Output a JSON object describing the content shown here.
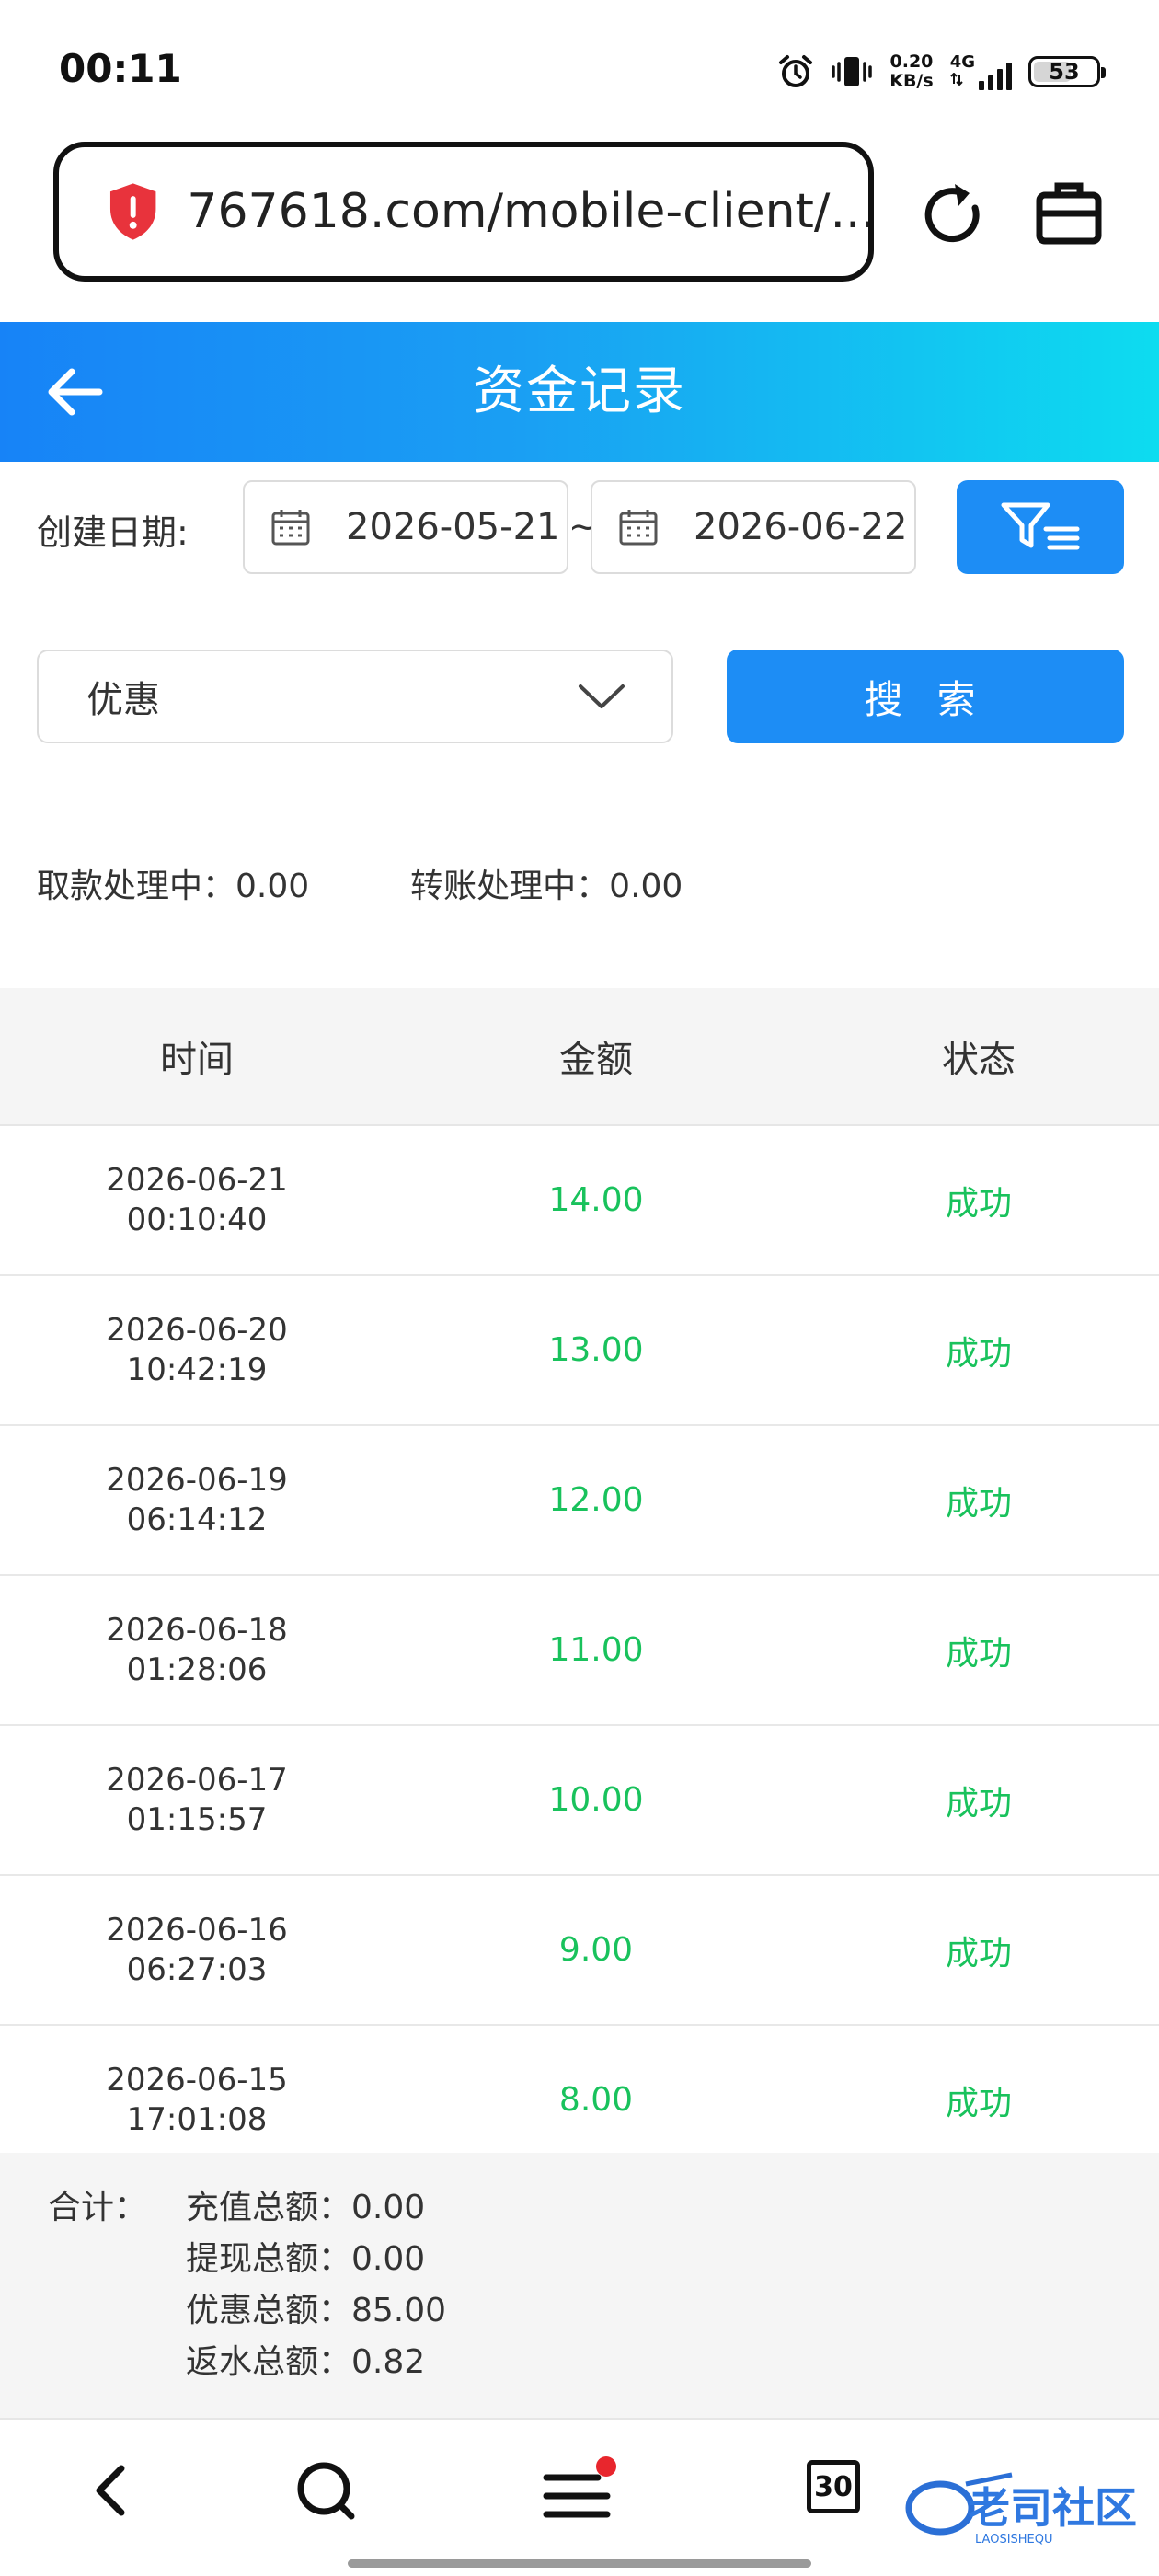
{
  "status_bar": {
    "time": "00:11",
    "net_speed_value": "0.20",
    "net_speed_unit": "KB/s",
    "network_type": "4G",
    "battery": "53"
  },
  "browser": {
    "url": "767618.com/mobile-client/..."
  },
  "header": {
    "title": "资金记录"
  },
  "filters": {
    "date_label": "创建日期:",
    "start_date": "2026-05-21",
    "separator": "~",
    "end_date": "2026-06-22",
    "type_selected": "优惠",
    "search_label": "搜 索"
  },
  "pending": {
    "withdraw": "取款处理中：0.00",
    "transfer": "转账处理中：0.00"
  },
  "table": {
    "headers": [
      "时间",
      "金额",
      "状态"
    ],
    "rows": [
      {
        "date": "2026-06-21",
        "time": "00:10:40",
        "amount": "14.00",
        "status": "成功"
      },
      {
        "date": "2026-06-20",
        "time": "10:42:19",
        "amount": "13.00",
        "status": "成功"
      },
      {
        "date": "2026-06-19",
        "time": "06:14:12",
        "amount": "12.00",
        "status": "成功"
      },
      {
        "date": "2026-06-18",
        "time": "01:28:06",
        "amount": "11.00",
        "status": "成功"
      },
      {
        "date": "2026-06-17",
        "time": "01:15:57",
        "amount": "10.00",
        "status": "成功"
      },
      {
        "date": "2026-06-16",
        "time": "06:27:03",
        "amount": "9.00",
        "status": "成功"
      },
      {
        "date": "2026-06-15",
        "time": "17:01:08",
        "amount": "8.00",
        "status": "成功"
      }
    ]
  },
  "totals": {
    "label": "合计：",
    "deposit": "充值总额：0.00",
    "withdrawal": "提现总额：0.00",
    "bonus": "优惠总额：85.00",
    "rebate": "返水总额：0.82"
  },
  "bottom_nav": {
    "tabs_count": "30"
  },
  "watermark_text": "老司社区 LAOSISHEQU",
  "colors": {
    "accent": "#1d8df5",
    "success": "#19c25c",
    "header_gradient_start": "#1783f7",
    "header_gradient_end": "#0ddcf0",
    "warning_shield": "#e8333c"
  }
}
